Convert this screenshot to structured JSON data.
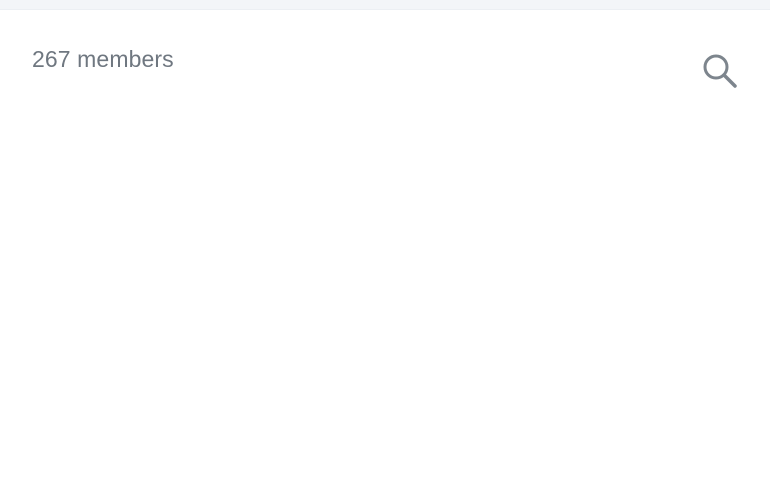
{
  "panel": {
    "member_count_label": "267 members",
    "search_icon": "search-icon"
  },
  "colors": {
    "text_muted": "#6f7780",
    "icon": "#7d858d",
    "top_strip": "#f3f5f8",
    "background": "#ffffff"
  }
}
